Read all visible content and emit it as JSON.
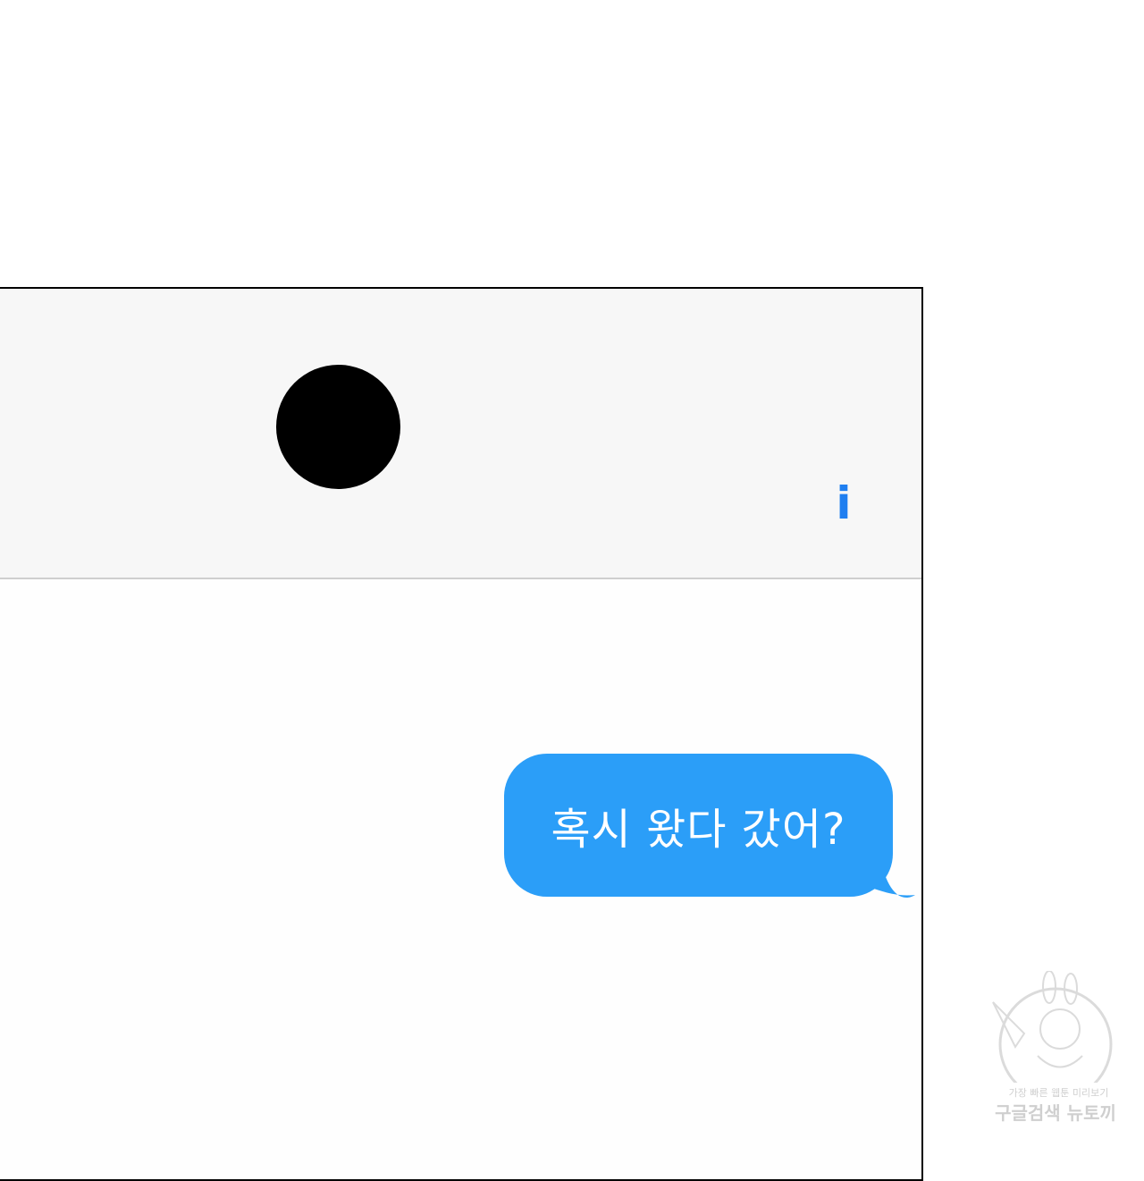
{
  "theme": {
    "accent": "#1f7ff0",
    "bubble": "#2b9ef8"
  },
  "header": {
    "info_label": "i",
    "info_icon": "info-icon",
    "avatar_icon": "avatar-icon"
  },
  "conversation": {
    "messages": [
      {
        "direction": "outgoing",
        "text": "혹시 왔다 갔어?"
      }
    ]
  },
  "watermark": {
    "line1": "가장 빠른 웹툰 미리보기",
    "line2": "구글검색 뉴토끼"
  }
}
